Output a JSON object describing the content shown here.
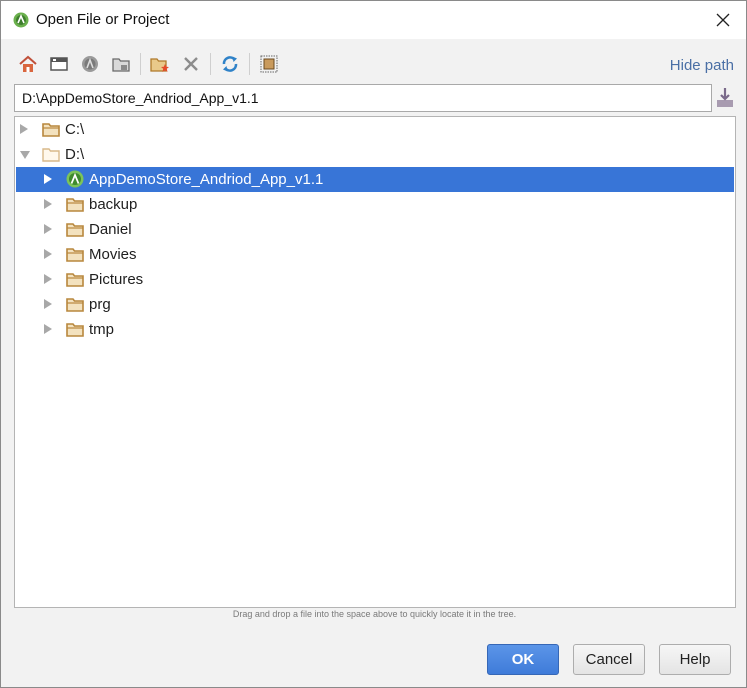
{
  "window": {
    "title": "Open File or Project",
    "icon": "android-studio-icon",
    "close_icon": "close-icon"
  },
  "toolbar": {
    "buttons": [
      "home-icon",
      "desktop-icon",
      "android-project-icon",
      "project-folder-icon",
      "new-folder-icon",
      "delete-icon",
      "refresh-icon",
      "show-hidden-icon"
    ],
    "hide_path_label": "Hide path"
  },
  "path": {
    "value": "D:\\AppDemoStore_Andriod_App_v1.1"
  },
  "tree": {
    "items": [
      {
        "label": "C:\\",
        "level": 0,
        "expanded": false,
        "icon": "folder-icon",
        "selected": false
      },
      {
        "label": "D:\\",
        "level": 0,
        "expanded": true,
        "icon": "folder-open-icon",
        "selected": false
      },
      {
        "label": "AppDemoStore_Andriod_App_v1.1",
        "level": 1,
        "expanded": false,
        "icon": "android-project-icon",
        "selected": true
      },
      {
        "label": "backup",
        "level": 1,
        "expanded": false,
        "icon": "folder-icon",
        "selected": false
      },
      {
        "label": "Daniel",
        "level": 1,
        "expanded": false,
        "icon": "folder-icon",
        "selected": false
      },
      {
        "label": "Movies",
        "level": 1,
        "expanded": false,
        "icon": "folder-icon",
        "selected": false
      },
      {
        "label": "Pictures",
        "level": 1,
        "expanded": false,
        "icon": "folder-icon",
        "selected": false
      },
      {
        "label": "prg",
        "level": 1,
        "expanded": false,
        "icon": "folder-icon",
        "selected": false
      },
      {
        "label": "tmp",
        "level": 1,
        "expanded": false,
        "icon": "folder-icon",
        "selected": false
      }
    ]
  },
  "hint_text": "Drag and drop a file into the space above to quickly locate it in the tree.",
  "buttons": {
    "ok": "OK",
    "cancel": "Cancel",
    "help": "Help"
  },
  "colors": {
    "selection": "#3875d7",
    "link": "#4a6fa5",
    "folder": "#c8a060",
    "ok_button": "#4a86dd"
  }
}
